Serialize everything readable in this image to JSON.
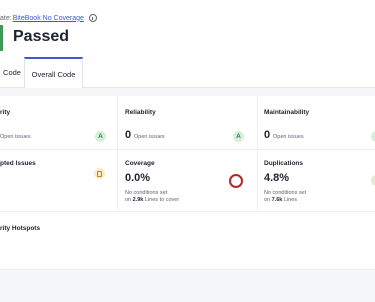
{
  "header": {
    "quality_gate_prefix": "ate:",
    "quality_gate_name": "BiteBook No Coverage",
    "status": "Passed",
    "status_color": "#3e9b57"
  },
  "tabs": [
    {
      "label": "Code",
      "active": false
    },
    {
      "label": "Overall Code",
      "active": true
    }
  ],
  "metrics": {
    "security": {
      "label": "rity",
      "value_text": "Open issues",
      "rating": "A"
    },
    "reliability": {
      "label": "Reliability",
      "value": "0",
      "value_text": "Open issues",
      "rating": "A"
    },
    "maintainability": {
      "label": "Maintainability",
      "value": "0",
      "value_text": "Open issues"
    },
    "accepted_issues": {
      "label": "pted Issues"
    },
    "coverage": {
      "label": "Coverage",
      "value": "0.0%",
      "line1": "No conditions set",
      "line2_prefix": "on",
      "line2_value": "2.9k",
      "line2_suffix": "Lines to cover"
    },
    "duplications": {
      "label": "Duplications",
      "value": "4.8%",
      "line1": "No conditions set",
      "line2_prefix": "on",
      "line2_value": "7.6k",
      "line2_suffix": "Lines"
    },
    "security_hotspots": {
      "label": "rity Hotspots"
    }
  },
  "colors": {
    "accent": "#3a5ccc",
    "rating_a_bg": "#d7efdb",
    "rating_a_fg": "#2f7d43",
    "coverage_ring": "#b22a2a"
  },
  "icons": {
    "info": "info-icon",
    "hotspot": "hotspot-shield-icon"
  }
}
